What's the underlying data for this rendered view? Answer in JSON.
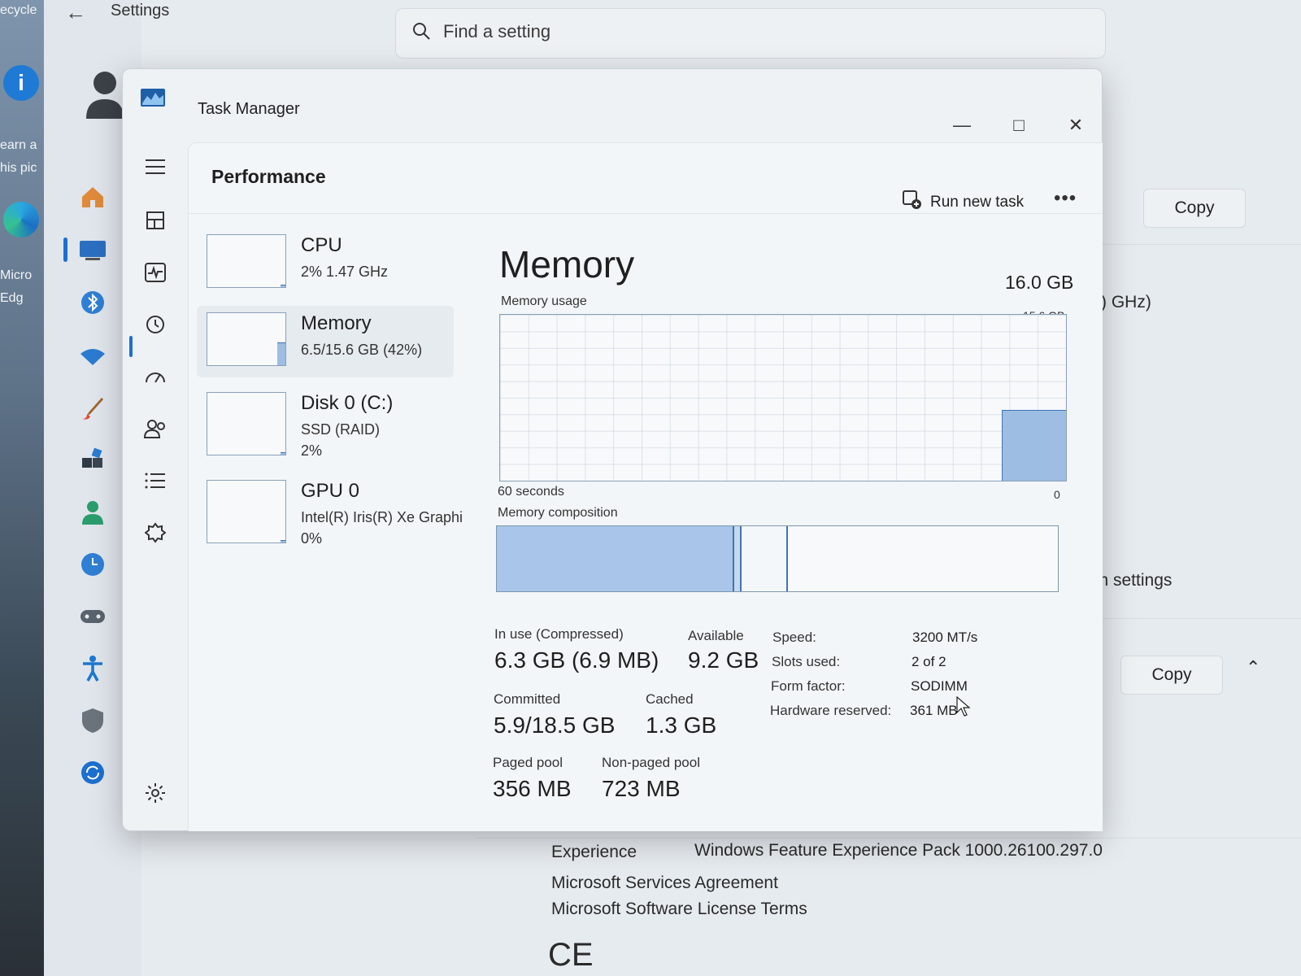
{
  "desktop": {
    "labels": [
      "ecycle",
      "earn a",
      "his pic",
      "Micro",
      "Edg"
    ]
  },
  "settings": {
    "title": "Settings",
    "search_placeholder": "Find a setting",
    "copy_label": "Copy",
    "copy_label_2": "Copy",
    "spec_snippet": ") GHz)",
    "system_settings_snippet": "em settings",
    "experience_label": "Experience",
    "experience_value": "Windows Feature Experience Pack 1000.26100.297.0",
    "links": [
      "Microsoft Services Agreement",
      "Microsoft Software License Terms"
    ],
    "footer_glyph": "CE"
  },
  "task_manager": {
    "title": "Task Manager",
    "window_buttons": {
      "minimize": "—",
      "maximize": "□",
      "close": "✕"
    },
    "page_title": "Performance",
    "run_new_task": "Run new task",
    "more": "•••",
    "devices": [
      {
        "name": "CPU",
        "line1": "2%  1.47 GHz",
        "line2": "",
        "level": 0.02
      },
      {
        "name": "Memory",
        "line1": "6.5/15.6 GB (42%)",
        "line2": "",
        "level": 0.42
      },
      {
        "name": "Disk 0 (C:)",
        "line1": "SSD (RAID)",
        "line2": "2%",
        "level": 0.02
      },
      {
        "name": "GPU 0",
        "line1": "Intel(R) Iris(R) Xe Graphi",
        "line2": "0%",
        "level": 0.0
      }
    ],
    "memory": {
      "title": "Memory",
      "total": "16.0 GB",
      "usage_label": "Memory usage",
      "usage_max": "15.6 GB",
      "time_label": "60 seconds",
      "zero_label": "0",
      "usage_level": 0.42,
      "composition_label": "Memory composition",
      "composition": {
        "in_use_fraction": 0.42,
        "modified_fraction": 0.01,
        "standby_fraction": 0.08
      },
      "stats": {
        "in_use_label": "In use (Compressed)",
        "in_use_value": "6.3 GB (6.9 MB)",
        "available_label": "Available",
        "available_value": "9.2 GB",
        "committed_label": "Committed",
        "committed_value": "5.9/18.5 GB",
        "cached_label": "Cached",
        "cached_value": "1.3 GB",
        "paged_label": "Paged pool",
        "paged_value": "356 MB",
        "nonpaged_label": "Non-paged pool",
        "nonpaged_value": "723 MB"
      },
      "specs": {
        "speed_label": "Speed:",
        "speed_value": "3200 MT/s",
        "slots_label": "Slots used:",
        "slots_value": "2 of 2",
        "form_label": "Form factor:",
        "form_value": "SODIMM",
        "reserved_label": "Hardware reserved:",
        "reserved_value": "361 MB"
      }
    }
  },
  "colors": {
    "accent": "#1d6fd0",
    "graph_fill": "#9dbde3",
    "graph_line": "#3f74b8",
    "composition_in_use": "#a9c6ea",
    "composition_border": "#7e95ad"
  }
}
